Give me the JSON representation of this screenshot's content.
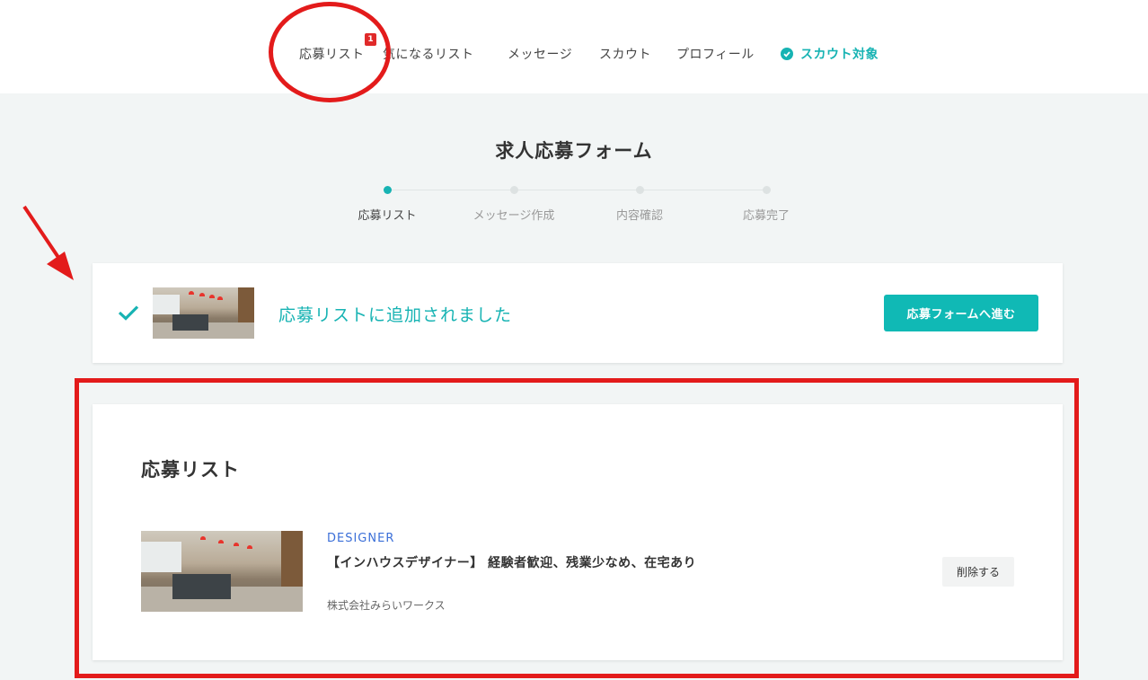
{
  "nav": {
    "items": [
      {
        "label": "応募リスト",
        "badge": "1"
      },
      {
        "label": "気になるリスト"
      },
      {
        "label": "メッセージ"
      },
      {
        "label": "スカウト"
      },
      {
        "label": "プロフィール"
      },
      {
        "label": "スカウト対象",
        "icon": "check-circle-icon",
        "accent": "#17b3b3"
      }
    ]
  },
  "page": {
    "title": "求人応募フォーム"
  },
  "stepper": {
    "steps": [
      "応募リスト",
      "メッセージ作成",
      "内容確認",
      "応募完了"
    ],
    "active_index": 0
  },
  "notice": {
    "message": "応募リストに追加されました",
    "button_label": "応募フォームへ進む",
    "accent": "#17b3b3"
  },
  "apply_list": {
    "title": "応募リスト",
    "items": [
      {
        "category": "DESIGNER",
        "job_title": "【インハウスデザイナー】 経験者歓迎、残業少なめ、在宅あり",
        "company": "株式会社みらいワークス",
        "delete_label": "削除する"
      }
    ]
  },
  "annotation_color": "#e31b1b"
}
